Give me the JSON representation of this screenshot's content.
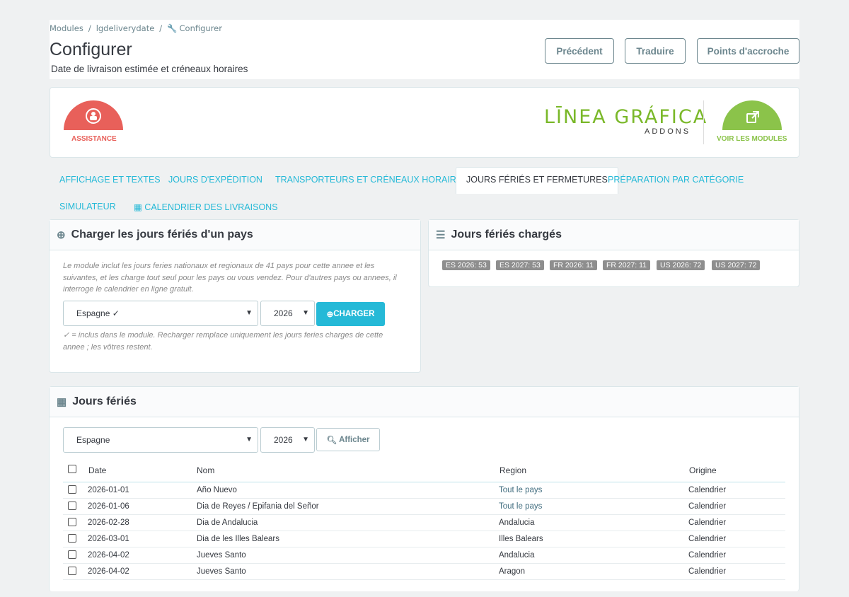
{
  "breadcrumb": {
    "items": [
      "Modules",
      "lgdeliverydate",
      "Configurer"
    ]
  },
  "header": {
    "title": "Configurer",
    "subtitle": "Date de livraison estimée et créneaux horaires",
    "buttons": {
      "previous": "Précédent",
      "translate": "Traduire",
      "hooks": "Points d'accroche"
    }
  },
  "banner": {
    "assistance_label": "ASSISTANCE",
    "logo_text": "LĪNEA GRÁFICA",
    "logo_sub": "ADDONS",
    "modules_label": "VOIR LES MODULES",
    "colors": {
      "assistance": "#e8605a",
      "modules": "#8bc34a",
      "logo": "#7ab829"
    }
  },
  "tabs": [
    {
      "label": "AFFICHAGE ET TEXTES",
      "active": false
    },
    {
      "label": "JOURS D'EXPÉDITION",
      "active": false
    },
    {
      "label": "TRANSPORTEURS ET CRÉNEAUX HORAIRES",
      "active": false
    },
    {
      "label": "JOURS FÉRIÉS ET FERMETURES",
      "active": true
    },
    {
      "label": "PRÉPARATION PAR CATÉGORIE",
      "active": false
    },
    {
      "label": "SIMULATEUR",
      "active": false
    },
    {
      "label": "CALENDRIER DES LIVRAISONS",
      "active": false,
      "icon": "calendar-icon"
    }
  ],
  "load_panel": {
    "title": "Charger les jours fériés d'un pays",
    "help_lines": [
      "Le module inclut les jours feries nationaux et regionaux de 41 pays pour cette annee et les",
      "suivantes, et les charge tout seul pour les pays ou vous vendez. Pour d'autres pays ou annees, il",
      "interroge le calendrier en ligne gratuit."
    ],
    "country_value": "Espagne ✓",
    "year_value": "2026",
    "button_label": "CHARGER",
    "note_lines": [
      "✓ = inclus dans le module. Recharger remplace uniquement les jours feries charges de cette",
      "annee ; les vôtres restent."
    ]
  },
  "loaded_panel": {
    "title": "Jours fériés chargés",
    "badges": [
      "ES 2026: 53",
      "ES 2027: 53",
      "FR 2026: 11",
      "FR 2027: 11",
      "US 2026: 72",
      "US 2027: 72"
    ]
  },
  "holidays_panel": {
    "title": "Jours fériés",
    "country_value": "Espagne",
    "year_value": "2026",
    "button_label": "Afficher",
    "columns": [
      "Date",
      "Nom",
      "Region",
      "Origine"
    ],
    "rows": [
      {
        "date": "2026-01-01",
        "name": "Año Nuevo",
        "region": "Tout le pays",
        "origin": "Calendrier"
      },
      {
        "date": "2026-01-06",
        "name": "Dia de Reyes / Epifania del Señor",
        "region": "Tout le pays",
        "origin": "Calendrier"
      },
      {
        "date": "2026-02-28",
        "name": "Dia de Andalucia",
        "region": "Andalucia",
        "origin": "Calendrier"
      },
      {
        "date": "2026-03-01",
        "name": "Dia de les Illes Balears",
        "region": "Illes Balears",
        "origin": "Calendrier"
      },
      {
        "date": "2026-04-02",
        "name": "Jueves Santo",
        "region": "Andalucia",
        "origin": "Calendrier"
      },
      {
        "date": "2026-04-02",
        "name": "Jueves Santo",
        "region": "Aragon",
        "origin": "Calendrier"
      }
    ]
  },
  "colors": {
    "accent": "#25b9d7",
    "badge": "#8e8e8e",
    "link": "#3e6b7d"
  }
}
